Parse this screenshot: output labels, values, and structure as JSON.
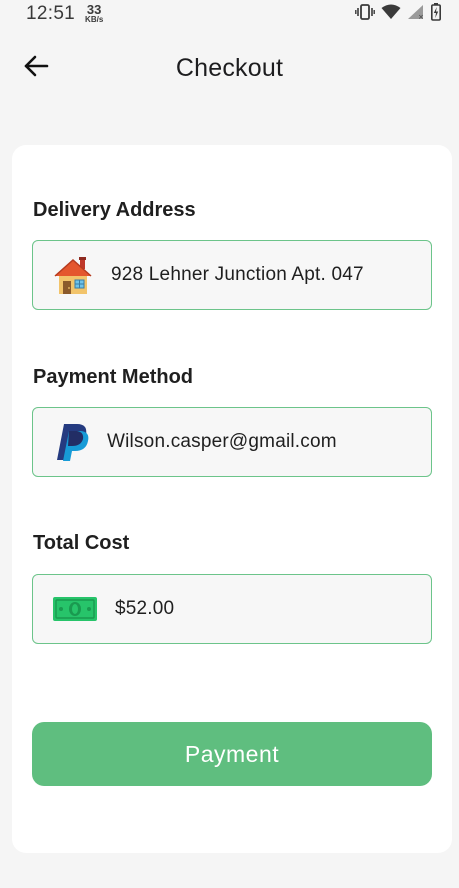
{
  "status_bar": {
    "time": "12:51",
    "net_speed_value": "33",
    "net_speed_unit": "KB/s",
    "icons": [
      "vibrate-icon",
      "wifi-icon",
      "signal-icon",
      "battery-icon"
    ]
  },
  "header": {
    "title": "Checkout",
    "back_icon": "arrow-left-icon"
  },
  "sections": {
    "delivery": {
      "label": "Delivery Address",
      "value": "928 Lehner Junction Apt. 047",
      "icon": "house-icon"
    },
    "payment": {
      "label": "Payment Method",
      "value": "Wilson.casper@gmail.com",
      "icon": "paypal-icon"
    },
    "total": {
      "label": "Total Cost",
      "value": "$52.00",
      "icon": "money-icon"
    }
  },
  "action": {
    "label": "Payment"
  },
  "colors": {
    "accent": "#5fbe7f",
    "field_border": "#6cc48a",
    "field_bg": "#f7f7f7",
    "page_bg": "#f5f5f5"
  }
}
